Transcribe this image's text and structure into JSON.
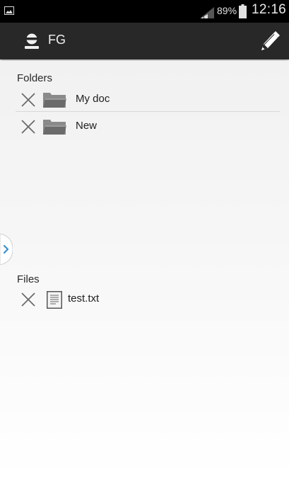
{
  "status_bar": {
    "battery_percent": "89%",
    "time": "12:16"
  },
  "action_bar": {
    "title": "FG"
  },
  "folders": {
    "header": "Folders",
    "items": [
      {
        "label": "My doc"
      },
      {
        "label": "New"
      }
    ]
  },
  "files": {
    "header": "Files",
    "items": [
      {
        "label": "test.txt"
      }
    ]
  },
  "icons": {
    "gallery": "gallery-icon",
    "signal": "signal-icon",
    "battery": "battery-icon",
    "user": "user-icon",
    "edit": "pencil-icon",
    "delete": "close-icon",
    "folder": "folder-icon",
    "file": "document-icon",
    "drawer": "chevron-right-icon"
  },
  "colors": {
    "status_bar": "#000000",
    "action_bar": "#282828",
    "accent": "#3a8fd0"
  }
}
